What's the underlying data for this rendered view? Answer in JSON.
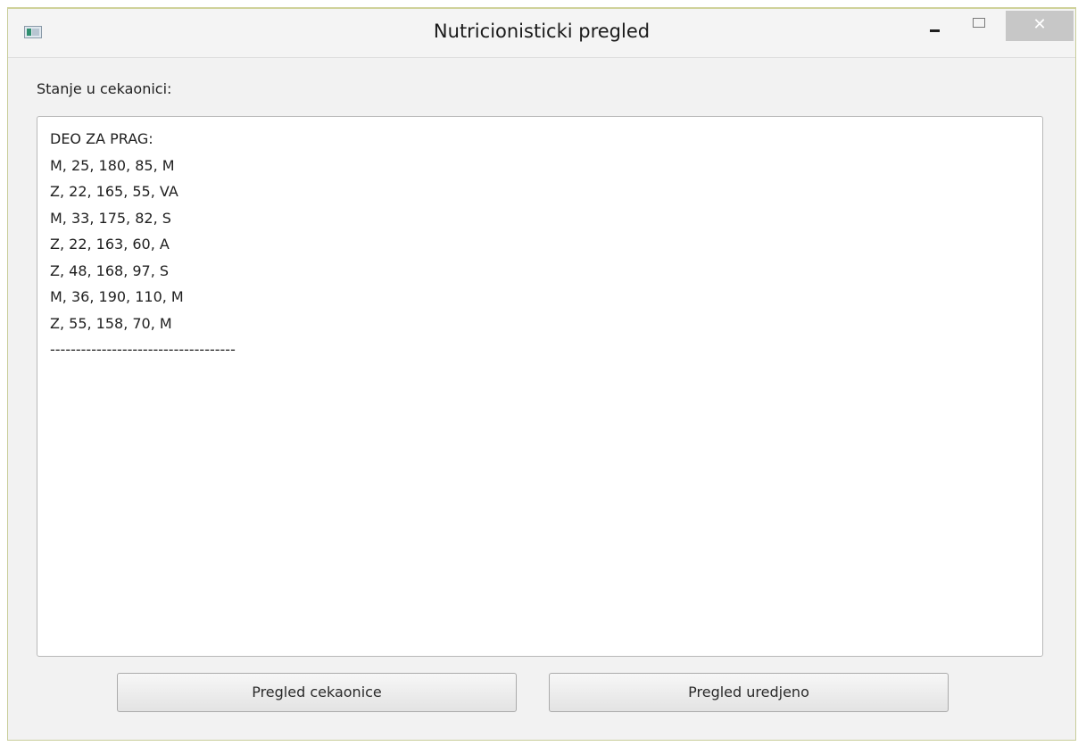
{
  "window": {
    "title": "Nutricionisticki pregled",
    "controls": {
      "minimize_icon": "minimize-icon",
      "maximize_icon": "maximize-icon",
      "close_label": "✕"
    }
  },
  "main": {
    "label": "Stanje u cekaonici:",
    "text_lines": [
      "DEO ZA PRAG:",
      "M, 25, 180, 85, M",
      "Z, 22, 165, 55, VA",
      "M, 33, 175, 82, S",
      "Z, 22, 163, 60, A",
      "Z, 48, 168, 97, S",
      "M, 36, 190, 110, M",
      "Z, 55, 158, 70, M",
      "------------------------------------"
    ],
    "buttons": {
      "left": "Pregled cekaonice",
      "right": "Pregled uredjeno"
    }
  }
}
